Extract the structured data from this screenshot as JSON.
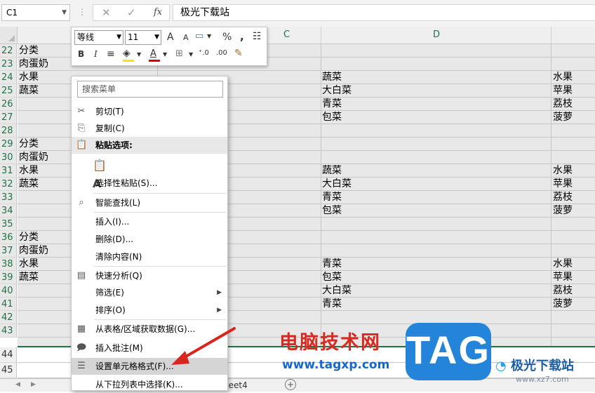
{
  "name_box": "C1",
  "formula_bar": {
    "cancel_icon": "✕",
    "enter_icon": "✓",
    "fx_label": "fx",
    "value": "极光下载站"
  },
  "columns": [
    "C",
    "D"
  ],
  "rows": [
    {
      "num": "22",
      "a": "分类",
      "d": "",
      "e": ""
    },
    {
      "num": "23",
      "a": "肉蛋奶",
      "d": "",
      "e": ""
    },
    {
      "num": "24",
      "a": "水果",
      "d": "蔬菜",
      "e": "水果"
    },
    {
      "num": "25",
      "a": "蔬菜",
      "d": "大白菜",
      "e": "苹果"
    },
    {
      "num": "26",
      "a": "",
      "d": "青菜",
      "e": "荔枝"
    },
    {
      "num": "27",
      "a": "",
      "d": "包菜",
      "e": "菠萝"
    },
    {
      "num": "28",
      "a": "",
      "d": "",
      "e": ""
    },
    {
      "num": "29",
      "a": "分类",
      "d": "",
      "e": ""
    },
    {
      "num": "30",
      "a": "肉蛋奶",
      "d": "",
      "e": ""
    },
    {
      "num": "31",
      "a": "水果",
      "d": "蔬菜",
      "e": "水果"
    },
    {
      "num": "32",
      "a": "蔬菜",
      "d": "大白菜",
      "e": "苹果"
    },
    {
      "num": "33",
      "a": "",
      "d": "青菜",
      "e": "荔枝"
    },
    {
      "num": "34",
      "a": "",
      "d": "包菜",
      "e": "菠萝"
    },
    {
      "num": "35",
      "a": "",
      "d": "",
      "e": ""
    },
    {
      "num": "36",
      "a": "分类",
      "d": "",
      "e": ""
    },
    {
      "num": "37",
      "a": "肉蛋奶",
      "d": "",
      "e": ""
    },
    {
      "num": "38",
      "a": "水果",
      "d": "青菜",
      "e": "水果"
    },
    {
      "num": "39",
      "a": "蔬菜",
      "d": "包菜",
      "e": "苹果"
    },
    {
      "num": "40",
      "a": "",
      "d": "大白菜",
      "e": "荔枝"
    },
    {
      "num": "41",
      "a": "",
      "d": "青菜",
      "e": "菠萝"
    },
    {
      "num": "42",
      "a": "",
      "d": "",
      "e": ""
    },
    {
      "num": "43",
      "a": "",
      "d": "",
      "e": ""
    },
    {
      "num": "44",
      "a": "",
      "d": "",
      "e": ""
    },
    {
      "num": "45",
      "a": "",
      "d": "",
      "e": ""
    }
  ],
  "mini_toolbar": {
    "font": "等线",
    "size": "11",
    "grow_font": "A",
    "shrink_font": "A",
    "percent": "%",
    "comma": ",",
    "bold": "B",
    "italic": "I",
    "font_color": "A"
  },
  "context_menu": {
    "search_placeholder": "搜索菜单",
    "cut": "剪切(T)",
    "copy": "复制(C)",
    "paste_options": "粘贴选项:",
    "paste_special": "选择性粘贴(S)...",
    "smart_lookup": "智能查找(L)",
    "insert": "插入(I)...",
    "delete": "删除(D)...",
    "clear": "清除内容(N)",
    "quick_analysis": "快速分析(Q)",
    "filter": "筛选(E)",
    "sort": "排序(O)",
    "get_data": "从表格/区域获取数据(G)...",
    "insert_comment": "插入批注(M)",
    "format_cells": "设置单元格格式(F)...",
    "pick_from_list": "从下拉列表中选择(K)..."
  },
  "sheet_tab": "heet4",
  "add_sheet": "+",
  "watermark": {
    "site_cn": "电脑技术网",
    "url": "www.tagxp.com",
    "tag": "TAG",
    "jg_brand": "极光下载站",
    "jg_url": "www.xz7.com"
  }
}
